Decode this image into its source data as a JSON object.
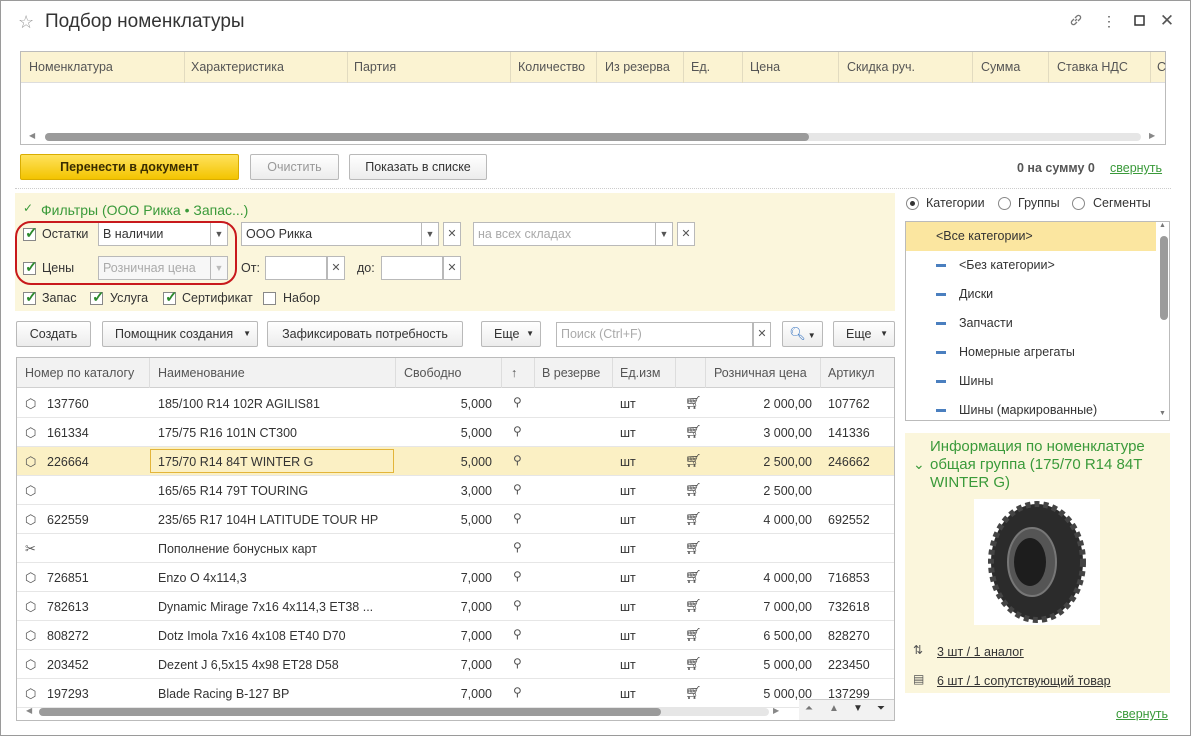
{
  "window": {
    "title": "Подбор номенклатуры"
  },
  "selected_table": {
    "columns": [
      "Номенклатура",
      "Характеристика",
      "Партия",
      "Количество",
      "Из резерва",
      "Ед.",
      "Цена",
      "Скидка руч.",
      "Сумма",
      "Ставка НДС",
      "С"
    ]
  },
  "actions": {
    "transfer_label": "Перенести в документ",
    "clear_label": "Очистить",
    "show_in_list_label": "Показать в списке",
    "total_text": "0 на сумму 0",
    "collapse_label": "свернуть"
  },
  "filters": {
    "title": "Фильтры (ООО Рикка • Запас...)",
    "stock_label": "Остатки",
    "stock_value": "В наличии",
    "org_value": "ООО Рикка",
    "warehouse_placeholder": "на всех складах",
    "prices_label": "Цены",
    "price_type_placeholder": "Розничная цена",
    "from_label": "От:",
    "to_label": "до:",
    "types": [
      {
        "label": "Запас",
        "checked": true
      },
      {
        "label": "Услуга",
        "checked": true
      },
      {
        "label": "Сертификат",
        "checked": true
      },
      {
        "label": "Набор",
        "checked": false
      }
    ]
  },
  "toolbar": {
    "create_label": "Создать",
    "wizard_label": "Помощник создания",
    "fix_need_label": "Зафиксировать потребность",
    "more_label": "Еще",
    "search_placeholder": "Поиск (Ctrl+F)",
    "more2_label": "Еще"
  },
  "grid": {
    "columns": [
      "Номер по каталогу",
      "Наименование",
      "Свободно",
      "↑",
      "В резерве",
      "Ед.изм",
      "",
      "Розничная цена",
      "Артикул"
    ],
    "rows": [
      {
        "icon": "box-icon",
        "catalog": "137760",
        "name": "185/100 R14 102R AGILIS81",
        "free": "5,000",
        "unit": "шт",
        "price": "2 000,00",
        "article": "107762"
      },
      {
        "icon": "box-icon",
        "catalog": "161334",
        "name": "175/75 R16 101N CT300",
        "free": "5,000",
        "unit": "шт",
        "price": "3 000,00",
        "article": "141336"
      },
      {
        "icon": "box-icon",
        "catalog": "226664",
        "name": "175/70 R14 84T WINTER G",
        "free": "5,000",
        "unit": "шт",
        "price": "2 500,00",
        "article": "246662"
      },
      {
        "icon": "box-icon",
        "catalog": "",
        "name": "165/65 R14 79T TOURING",
        "free": "3,000",
        "unit": "шт",
        "price": "2 500,00",
        "article": ""
      },
      {
        "icon": "box-icon",
        "catalog": "622559",
        "name": "235/65 R17 104H LATITUDE TOUR HP",
        "free": "5,000",
        "unit": "шт",
        "price": "4 000,00",
        "article": "692552"
      },
      {
        "icon": "tools-icon",
        "catalog": "",
        "name": "Пополнение бонусных карт",
        "free": "",
        "unit": "шт",
        "price": "",
        "article": ""
      },
      {
        "icon": "box-icon",
        "catalog": "726851",
        "name": "Enzo O 4x114,3",
        "free": "7,000",
        "unit": "шт",
        "price": "4 000,00",
        "article": "716853"
      },
      {
        "icon": "box-icon",
        "catalog": "782613",
        "name": "Dynamic Mirage 7x16 4x114,3 ET38 ...",
        "free": "7,000",
        "unit": "шт",
        "price": "7 000,00",
        "article": "732618"
      },
      {
        "icon": "box-icon",
        "catalog": "808272",
        "name": "Dotz Imola 7x16 4x108 ET40 D70",
        "free": "7,000",
        "unit": "шт",
        "price": "6 500,00",
        "article": "828270"
      },
      {
        "icon": "box-icon",
        "catalog": "203452",
        "name": "Dezent J 6,5x15 4x98 ET28 D58",
        "free": "7,000",
        "unit": "шт",
        "price": "5 000,00",
        "article": "223450"
      },
      {
        "icon": "box-icon",
        "catalog": "197293",
        "name": "Blade Racing B-127 BP",
        "free": "7,000",
        "unit": "шт",
        "price": "5 000,00",
        "article": "137299"
      }
    ]
  },
  "side": {
    "radio_categories": "Категории",
    "radio_groups": "Группы",
    "radio_segments": "Сегменты",
    "categories": [
      "<Все категории>",
      "<Без категории>",
      "Диски",
      "Запчасти",
      "Номерные агрегаты",
      "Шины",
      "Шины (маркированные)"
    ],
    "info_title": "Информация по номенклатуре общая группа (175/70 R14 84T WINTER G)",
    "analog_link": "3 шт / 1 аналог",
    "related_link": "6 шт / 1 сопутствующий товар",
    "collapse_label": "свернуть"
  }
}
